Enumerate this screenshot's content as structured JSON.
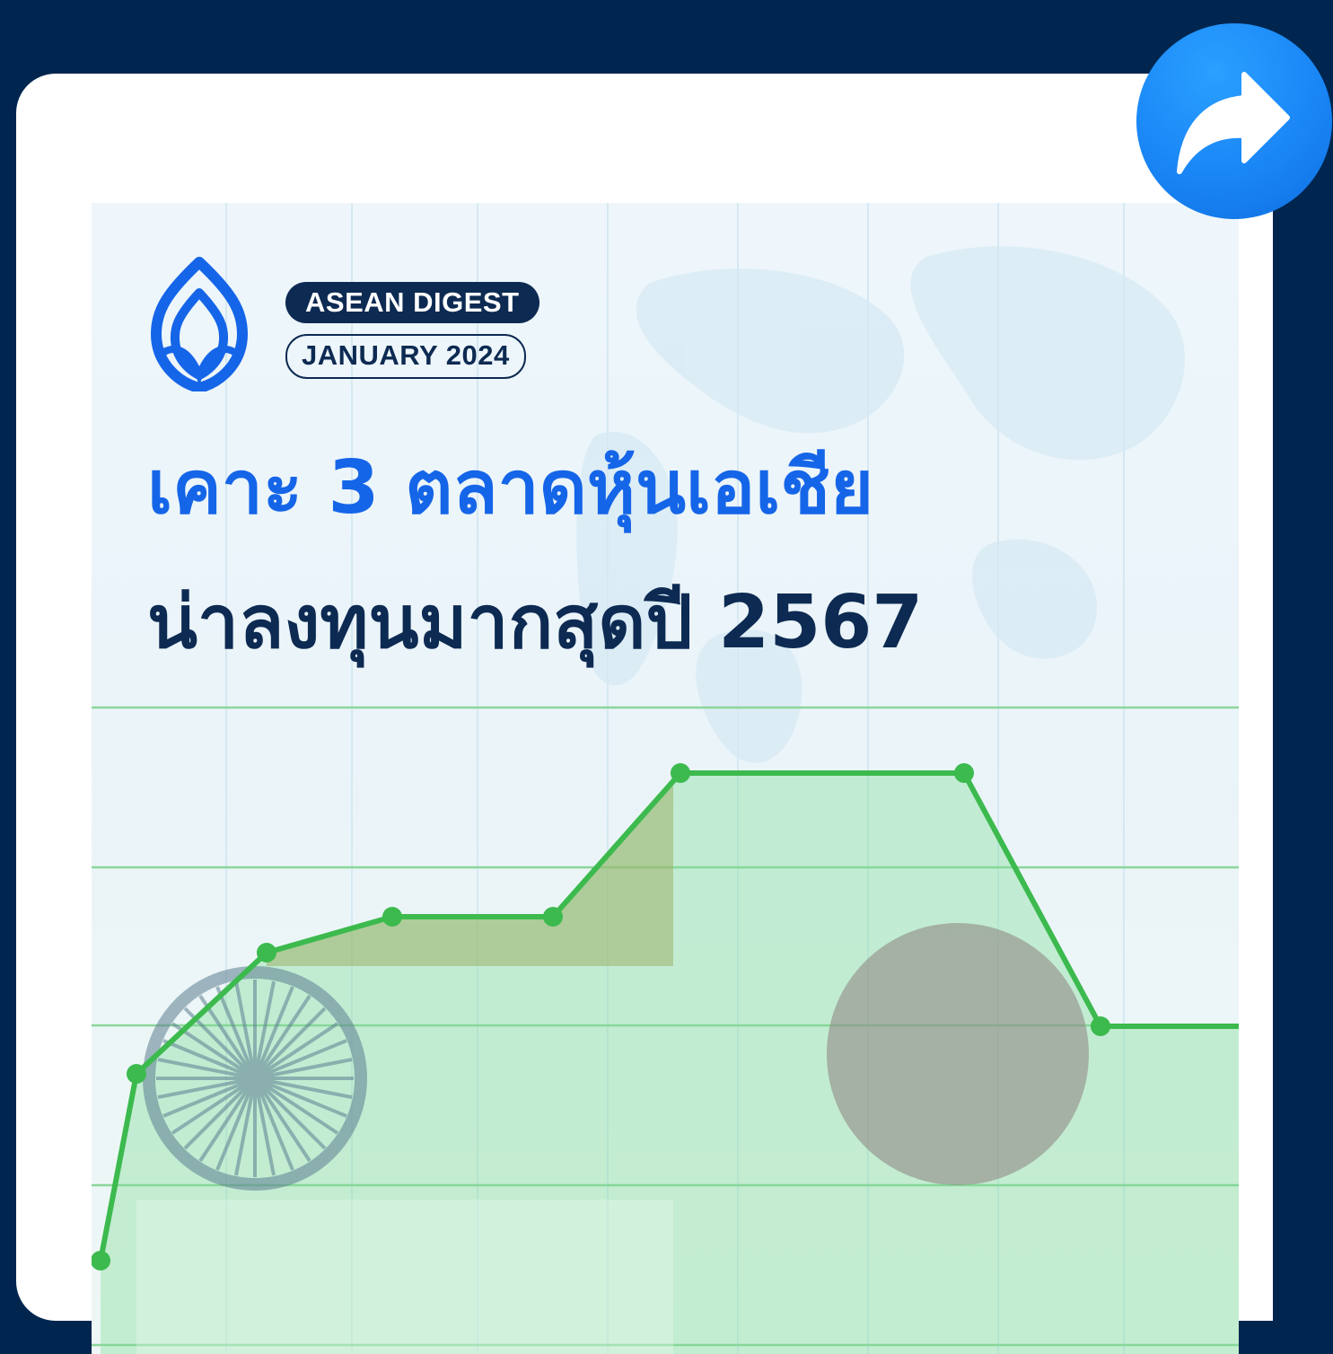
{
  "badge": {
    "series": "ASEAN DIGEST",
    "issue": "JANUARY 2024"
  },
  "headline": {
    "line1": "เคาะ 3 ตลาดหุ้นเอเชีย",
    "line2": "น่าลงทุนมากสุดปี 2567"
  },
  "colors": {
    "page_background": "#00264f",
    "card": "#ffffff",
    "headline_accent": "#1565e8",
    "headline_dark": "#0d2a52",
    "chart_line": "#3cba4e",
    "share_button": "#1a86f6"
  },
  "icons": {
    "logo": "lotus-logo-icon",
    "share": "share-arrow-icon",
    "india": "ashoka-chakra-icon",
    "japan": "rising-sun-circle-icon"
  }
}
